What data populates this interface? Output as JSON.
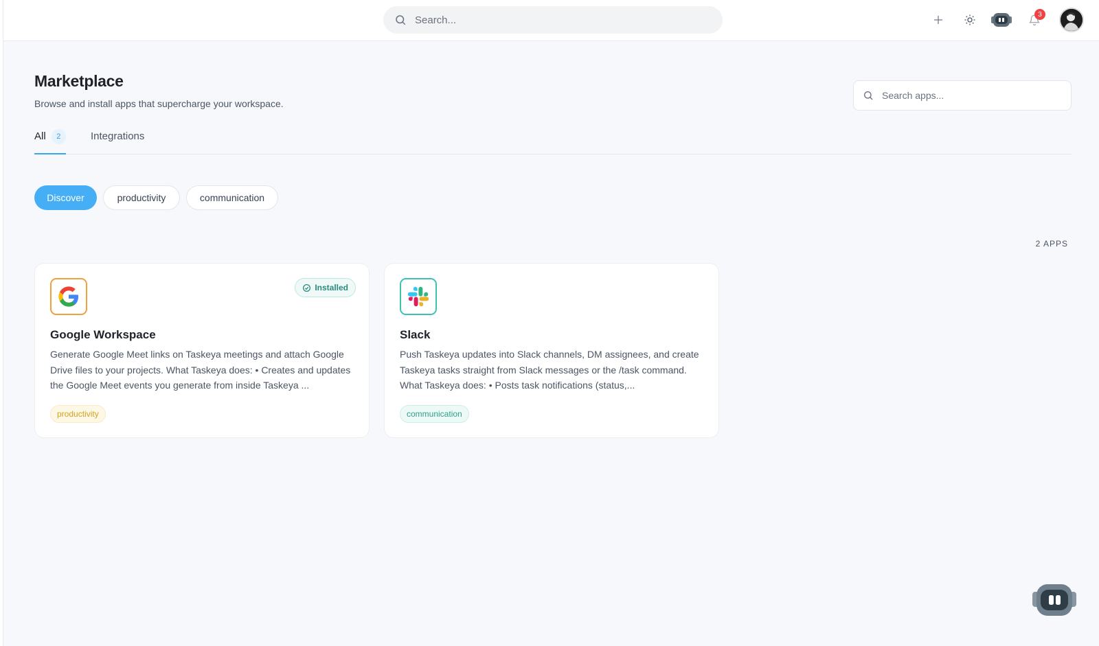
{
  "topbar": {
    "search_placeholder": "Search...",
    "notification_count": "3",
    "icons": [
      "plus-icon",
      "sun-icon",
      "bot-icon",
      "bell-icon"
    ]
  },
  "page": {
    "title": "Marketplace",
    "subtitle": "Browse and install apps that supercharge your workspace.",
    "search_placeholder": "Search apps..."
  },
  "tabs": [
    {
      "label": "All",
      "count": "2",
      "active": true
    },
    {
      "label": "Integrations"
    }
  ],
  "filters": [
    {
      "label": "Discover",
      "active": true
    },
    {
      "label": "productivity"
    },
    {
      "label": "communication"
    }
  ],
  "apps_count_label": "2 APPS",
  "apps": [
    {
      "name": "Google Workspace",
      "description": "Generate Google Meet links on Taskeya meetings and attach Google Drive files to your projects. What Taskeya does: • Creates and updates the Google Meet events you generate from inside Taskeya ...",
      "tag": "productivity",
      "installed_label": "Installed",
      "logo": "google-icon",
      "accent": "#f0a13a"
    },
    {
      "name": "Slack",
      "description": "Push Taskeya updates into Slack channels, DM assignees, and create Taskeya tasks straight from Slack messages or the /task command. What Taskeya does: • Posts task notifications (status,...",
      "tag": "communication",
      "logo": "slack-icon",
      "accent": "#3fc1b0"
    }
  ],
  "colors": {
    "accent": "#46aef4",
    "notification": "#ef4444",
    "productivity": "#d4a21d",
    "communication": "#2e9f8b"
  }
}
